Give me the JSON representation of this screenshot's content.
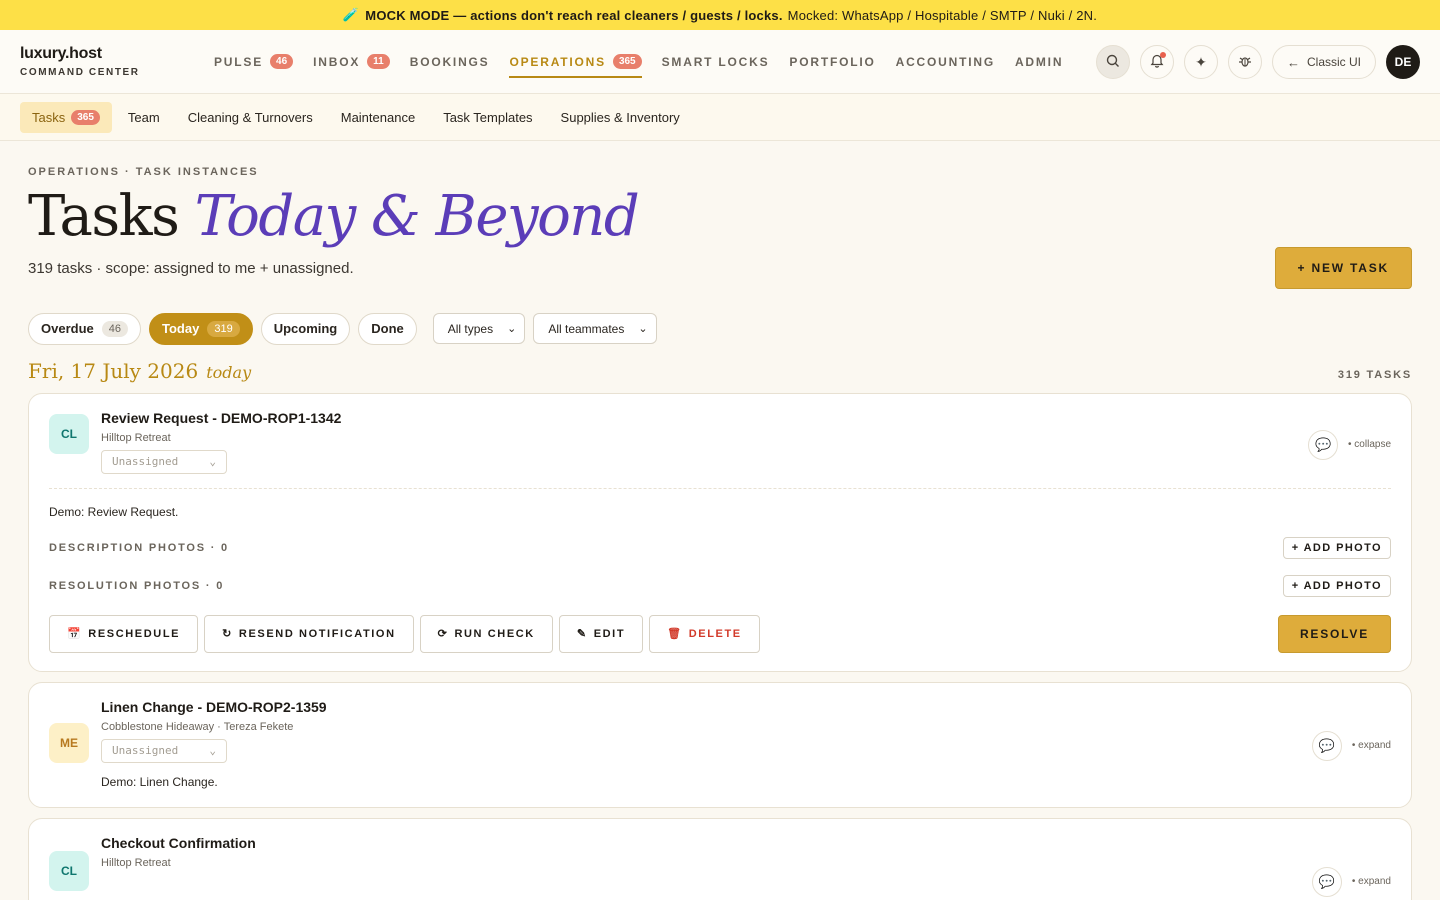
{
  "banner": {
    "icon": "🧪",
    "bold_text": "MOCK MODE — actions don't reach real cleaners / guests / locks.",
    "rest_text": "Mocked: WhatsApp / Hospitable / SMTP / Nuki / 2N."
  },
  "brand": {
    "name": "luxury.host",
    "subtitle": "COMMAND CENTER"
  },
  "nav": [
    {
      "label": "PULSE",
      "badge": "46"
    },
    {
      "label": "INBOX",
      "badge": "11"
    },
    {
      "label": "BOOKINGS"
    },
    {
      "label": "OPERATIONS",
      "badge": "365",
      "active": true
    },
    {
      "label": "SMART LOCKS"
    },
    {
      "label": "PORTFOLIO"
    },
    {
      "label": "ACCOUNTING"
    },
    {
      "label": "ADMIN"
    }
  ],
  "topright": {
    "search_icon": "⌕",
    "bell_icon": "🔔",
    "spark_icon": "✦",
    "bug_icon": "✲",
    "classic_label": "Classic UI",
    "classic_arrow": "←",
    "avatar": "DE"
  },
  "subnav": [
    {
      "label": "Tasks",
      "badge": "365",
      "active": true
    },
    {
      "label": "Team"
    },
    {
      "label": "Cleaning & Turnovers"
    },
    {
      "label": "Maintenance"
    },
    {
      "label": "Task Templates"
    },
    {
      "label": "Supplies & Inventory"
    }
  ],
  "page": {
    "breadcrumb": "OPERATIONS · TASK INSTANCES",
    "title_plain": "Tasks",
    "title_accent": "Today & Beyond",
    "subtitle": "319 tasks · scope: assigned to me + unassigned.",
    "new_task": "+ NEW TASK"
  },
  "filters": {
    "chips": [
      {
        "label": "Overdue",
        "count": "46"
      },
      {
        "label": "Today",
        "count": "319",
        "active": true
      },
      {
        "label": "Upcoming"
      },
      {
        "label": "Done"
      }
    ],
    "types_select": "All types",
    "team_select": "All teammates",
    "chevron": "⌄"
  },
  "day": {
    "date": "Fri, 17 July 2026",
    "label": "today",
    "count": "319 TASKS"
  },
  "tasks": [
    {
      "avatar": "CL",
      "title": "Review Request - DEMO-ROP1-1342",
      "meta": "Hilltop Retreat",
      "assignee": "Unassigned",
      "toggle": "• collapse",
      "description": "Demo: Review Request.",
      "desc_photos": "DESCRIPTION PHOTOS · 0",
      "res_photos": "RESOLUTION PHOTOS · 0",
      "add_photo": "+ ADD PHOTO",
      "actions": {
        "reschedule": "RESCHEDULE",
        "reschedule_icon": "📅",
        "resend": "RESEND NOTIFICATION",
        "resend_icon": "↻",
        "run_check": "RUN CHECK",
        "run_icon": "⟳",
        "edit": "EDIT",
        "edit_icon": "✎",
        "delete": "DELETE",
        "delete_icon": "🗑",
        "resolve": "RESOLVE"
      }
    },
    {
      "avatar": "ME",
      "title": "Linen Change - DEMO-ROP2-1359",
      "meta": "Cobblestone Hideaway · Tereza Fekete",
      "assignee": "Unassigned",
      "toggle": "• expand",
      "description": "Demo: Linen Change."
    },
    {
      "avatar": "CL",
      "title": "Checkout Confirmation",
      "meta": "Hilltop Retreat",
      "toggle": "• expand"
    }
  ],
  "chat_icon": "💬",
  "colors": {
    "accent": "#b88914",
    "brand_purple": "#5b3db8",
    "banner": "#fde047",
    "badge": "#e87f6b"
  }
}
